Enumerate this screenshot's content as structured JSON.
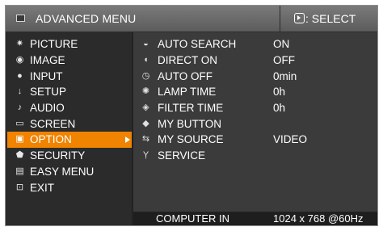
{
  "header": {
    "title": "ADVANCED MENU",
    "select_label": ": SELECT"
  },
  "left_menu": [
    {
      "label": "PICTURE",
      "icon": "picture-icon",
      "glyph": "✷"
    },
    {
      "label": "IMAGE",
      "icon": "image-icon",
      "glyph": "◉"
    },
    {
      "label": "INPUT",
      "icon": "input-icon",
      "glyph": "●"
    },
    {
      "label": "SETUP",
      "icon": "setup-icon",
      "glyph": "↓"
    },
    {
      "label": "AUDIO",
      "icon": "audio-icon",
      "glyph": "♪"
    },
    {
      "label": "SCREEN",
      "icon": "screen-icon",
      "glyph": "▭"
    },
    {
      "label": "OPTION",
      "icon": "option-icon",
      "glyph": "▣"
    },
    {
      "label": "SECURITY",
      "icon": "security-icon",
      "glyph": "⬟"
    },
    {
      "label": "EASY MENU",
      "icon": "easy-menu-icon",
      "glyph": "▤"
    },
    {
      "label": "EXIT",
      "icon": "exit-icon",
      "glyph": "⊡"
    }
  ],
  "selected_left_item": "OPTION",
  "option_items": [
    {
      "label": "AUTO SEARCH",
      "value": "ON",
      "icon": "auto-search-icon",
      "glyph": "◒"
    },
    {
      "label": "DIRECT ON",
      "value": "OFF",
      "icon": "direct-on-icon",
      "glyph": "◖"
    },
    {
      "label": "AUTO OFF",
      "value": "0min",
      "icon": "auto-off-icon",
      "glyph": "◷"
    },
    {
      "label": "LAMP TIME",
      "value": "0h",
      "icon": "lamp-time-icon",
      "glyph": "✺"
    },
    {
      "label": "FILTER TIME",
      "value": "0h",
      "icon": "filter-time-icon",
      "glyph": "◈"
    },
    {
      "label": "MY BUTTON",
      "value": "",
      "icon": "my-button-icon",
      "glyph": "◆"
    },
    {
      "label": "MY SOURCE",
      "value": "VIDEO",
      "icon": "my-source-icon",
      "glyph": "⇆"
    },
    {
      "label": "SERVICE",
      "value": "",
      "icon": "service-icon",
      "glyph": "Ỵ"
    }
  ],
  "footer": {
    "source": "COMPUTER IN",
    "resolution": "1024 x 768 @60Hz"
  },
  "colors": {
    "highlight": "#f08300",
    "background": "#232323",
    "header": "#6a6a6a"
  }
}
